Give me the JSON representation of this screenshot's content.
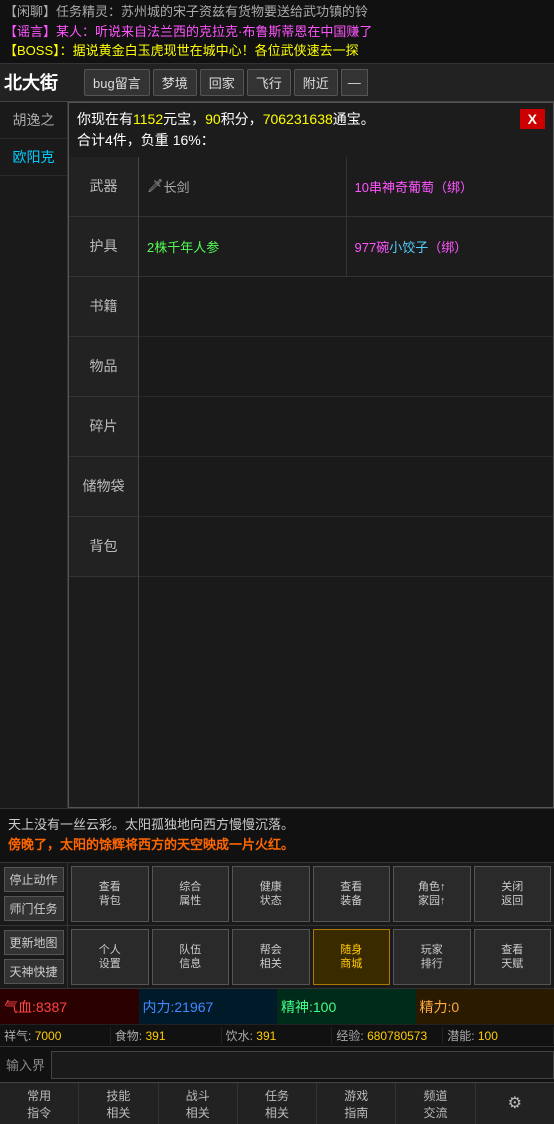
{
  "messages": [
    {
      "type": "idle",
      "text": "【闲聊】任务精灵：苏州城的宋子资兹有货物要送给武功镇的铃"
    },
    {
      "type": "rumor",
      "text": "【谣言】某人：听说来自法兰西的克拉克·布鲁斯蒂恩在中国赚了"
    },
    {
      "type": "boss",
      "text": "【BOSS】：据说黄金白玉虎现世在城中心！各位武侠速去一探"
    }
  ],
  "nav": {
    "title": "北大街",
    "buttons": [
      "bug留言",
      "梦境",
      "回家",
      "飞行",
      "附近",
      "—"
    ]
  },
  "sidebar": {
    "players": [
      "胡逸之",
      "欧阳克"
    ]
  },
  "inventory": {
    "header_line1": "你现在有1152元宝，90积分，706231638通宝。",
    "header_line2": "合计4件，负重 16%：",
    "close_label": "X",
    "yuan_bao": "1152",
    "ji_fen": "90",
    "tong_bao": "706231638",
    "total_items": "4",
    "weight_pct": "16",
    "categories": [
      {
        "id": "weapon",
        "label": "武器"
      },
      {
        "id": "armor",
        "label": "护具"
      },
      {
        "id": "book",
        "label": "书籍"
      },
      {
        "id": "item",
        "label": "物品"
      },
      {
        "id": "shard",
        "label": "碎片"
      },
      {
        "id": "storage",
        "label": "储物袋"
      },
      {
        "id": "bag",
        "label": "背包"
      }
    ],
    "items": [
      [
        {
          "name": "🗡 长剑",
          "type": "weapon"
        },
        {
          "name": "10串神奇葡萄（绑）",
          "type": "special"
        }
      ],
      [
        {
          "name": "2株千年人参",
          "type": "herb"
        },
        {
          "name": "977碗小饺子（绑）",
          "type": "food-bound"
        }
      ]
    ]
  },
  "scene": {
    "normal": "天上没有一丝云彩。太阳孤独地向西方慢慢沉落。",
    "sunset": "傍晚了，太阳的馀辉将西方的天空映成一片火红。"
  },
  "left_actions": {
    "stop": "停止动作",
    "sect_task": "师门任务",
    "update_map": "更新地图",
    "shortcut": "天神快捷"
  },
  "action_grid_1": [
    {
      "label": "查看\n背包",
      "highlighted": false
    },
    {
      "label": "综合\n属性",
      "highlighted": false
    },
    {
      "label": "健康\n状态",
      "highlighted": false
    },
    {
      "label": "查看\n装备",
      "highlighted": false
    },
    {
      "label": "角色↑\n家园↑",
      "highlighted": false
    },
    {
      "label": "关闭\n返回",
      "highlighted": false
    }
  ],
  "action_grid_2": [
    {
      "label": "个人\n设置",
      "highlighted": false
    },
    {
      "label": "队伍\n信息",
      "highlighted": false
    },
    {
      "label": "帮会\n相关",
      "highlighted": false
    },
    {
      "label": "随身\n商城",
      "highlighted": true
    },
    {
      "label": "玩家\n排行",
      "highlighted": false
    },
    {
      "label": "查看\n天赋",
      "highlighted": false
    }
  ],
  "stats": {
    "hp_label": "气血:",
    "hp_val": "8387",
    "mp_label": "内力:",
    "mp_val": "21967",
    "sp_label": "精神:",
    "sp_val": "100",
    "st_label": "精力:",
    "st_val": "0"
  },
  "stats2": {
    "qi_label": "祥气:",
    "qi_val": "7000",
    "food_label": "食物:",
    "food_val": "391",
    "water_label": "饮水:",
    "water_val": "391",
    "exp_label": "经验:",
    "exp_val": "680780573",
    "potential_label": "潜能:",
    "potential_val": "100"
  },
  "bottom_nav": [
    {
      "label": "常用\n指令",
      "active": false
    },
    {
      "label": "技能\n相关",
      "active": false
    },
    {
      "label": "战斗\n相关",
      "active": false
    },
    {
      "label": "任务\n相关",
      "active": false
    },
    {
      "label": "游戏\n指南",
      "active": false
    },
    {
      "label": "频道\n交流",
      "active": false
    },
    {
      "label": "⚙",
      "active": false
    }
  ],
  "input": {
    "label": "输入界",
    "placeholder": ""
  }
}
